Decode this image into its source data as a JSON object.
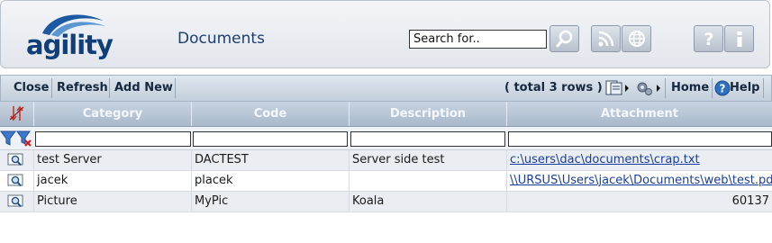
{
  "app": {
    "logo_text": "agility",
    "page_title": "Documents"
  },
  "search": {
    "value": "Search for.."
  },
  "header_icons": [
    "magnifier-icon",
    "rss-icon",
    "globe-icon",
    "help-icon",
    "info-icon"
  ],
  "toolbar": {
    "close_label": "Close",
    "refresh_label": "Refresh",
    "add_new_label": "Add New",
    "row_count_text": "( total 3 rows )",
    "home_label": "Home",
    "help_label": "Help"
  },
  "grid": {
    "columns": [
      "Category",
      "Code",
      "Description",
      "Attachment"
    ],
    "rows": [
      {
        "category": "test Server",
        "code": "DACTEST",
        "description": "Server side test",
        "attachment": "c:\\users\\dac\\documents\\crap.txt",
        "attachment_is_link": true
      },
      {
        "category": "jacek",
        "code": "placek",
        "description": "",
        "attachment": "\\\\URSUS\\Users\\jacek\\Documents\\web\\test.pdf",
        "attachment_is_link": true
      },
      {
        "category": "Picture",
        "code": "MyPic",
        "description": "Koala",
        "attachment": "60137",
        "attachment_is_link": false
      }
    ]
  },
  "colors": {
    "brand_blue": "#0f3e78",
    "link": "#1a3ea0",
    "header_bar": "#b3c2d3"
  }
}
